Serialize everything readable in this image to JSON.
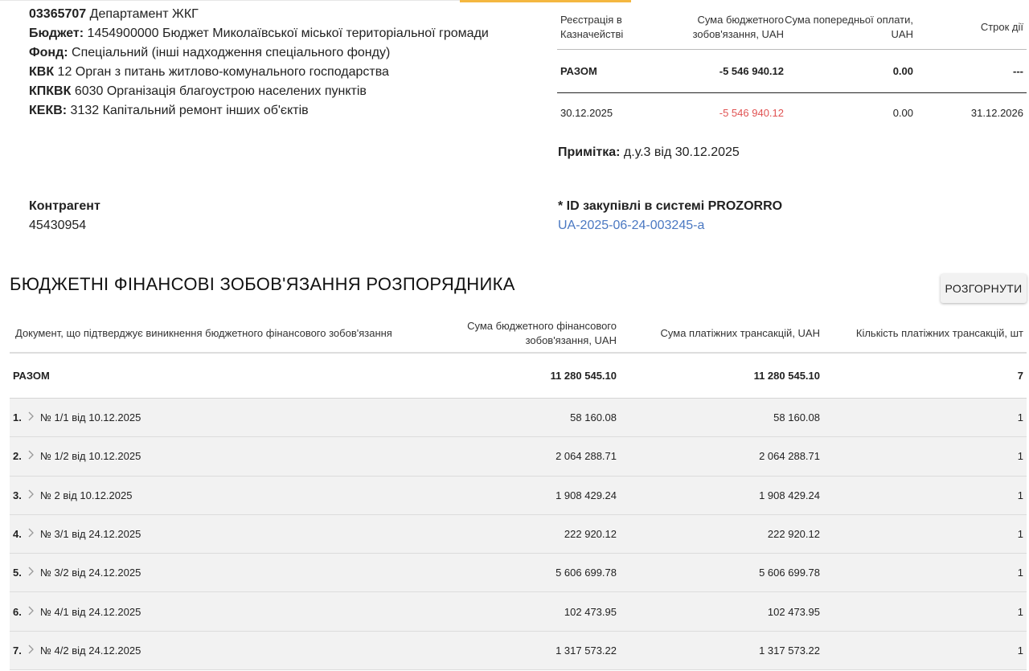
{
  "info": {
    "org_code": "03365707",
    "org_name": "Департамент ЖКГ",
    "budget_label": "Бюджет:",
    "budget_value": "1454900000 Бюджет Миколаївської міської територіальної громади",
    "fund_label": "Фонд:",
    "fund_value": "Спеціальний (інші надходження спеціального фонду)",
    "kvk_label": "КВК",
    "kvk_value": "12 Орган з питань житлово-комунального господарства",
    "kpkvk_label": "КПКВК",
    "kpkvk_value": "6030 Організація благоустрою населених пунктів",
    "kekv_label": "КЕКВ:",
    "kekv_value": "3132 Капітальний ремонт інших об'єктів"
  },
  "contragent": {
    "label": "Контрагент",
    "value": "45430954"
  },
  "registry_table": {
    "headers": [
      "Реєстрація в Казначействі",
      "Сума бюджетного зобов'язання, UAH",
      "Сума попередньої оплати, UAH",
      "Строк дії"
    ],
    "total": [
      "РАЗОМ",
      "-5 546 940.12",
      "0.00",
      "---"
    ],
    "row": [
      "30.12.2025",
      "-5 546 940.12",
      "0.00",
      "31.12.2026"
    ]
  },
  "note": {
    "label": "Примітка:",
    "value": "д.у.3 від 30.12.2025"
  },
  "prozorro": {
    "label": "* ID закупівлі в системі PROZORRO",
    "link": "UA-2025-06-24-003245-a"
  },
  "section": {
    "title": "БЮДЖЕТНІ ФІНАНСОВІ ЗОБОВ'ЯЗАННЯ РОЗПОРЯДНИКА",
    "expand_label": "РОЗГОРНУТИ"
  },
  "obligations": {
    "headers": [
      "Документ, що підтверджує виникнення бюджетного фінансового зобов'язання",
      "Сума бюджетного фінансового зобов'язання, UAH",
      "Сума платіжних трансакцій, UAH",
      "Кількість платіжних трансакцій, шт"
    ],
    "total": {
      "label": "РАЗОМ",
      "sum": "11 280 545.10",
      "paid": "11 280 545.10",
      "count": "7"
    },
    "rows": [
      {
        "n": "1.",
        "doc": "№ 1/1 від 10.12.2025",
        "sum": "58 160.08",
        "paid": "58 160.08",
        "count": "1"
      },
      {
        "n": "2.",
        "doc": "№ 1/2 від 10.12.2025",
        "sum": "2 064 288.71",
        "paid": "2 064 288.71",
        "count": "1"
      },
      {
        "n": "3.",
        "doc": "№ 2 від 10.12.2025",
        "sum": "1 908 429.24",
        "paid": "1 908 429.24",
        "count": "1"
      },
      {
        "n": "4.",
        "doc": "№ 3/1 від 24.12.2025",
        "sum": "222 920.12",
        "paid": "222 920.12",
        "count": "1"
      },
      {
        "n": "5.",
        "doc": "№ 3/2 від 24.12.2025",
        "sum": "5 606 699.78",
        "paid": "5 606 699.78",
        "count": "1"
      },
      {
        "n": "6.",
        "doc": "№ 4/1 від 24.12.2025",
        "sum": "102 473.95",
        "paid": "102 473.95",
        "count": "1"
      },
      {
        "n": "7.",
        "doc": "№ 4/2 від 24.12.2025",
        "sum": "1 317 573.22",
        "paid": "1 317 573.22",
        "count": "1"
      }
    ]
  },
  "colors": {
    "accent": "#f4b740",
    "negative": "#e05252",
    "link": "#4a78c2"
  },
  "icons": {
    "row_expand": "chevron-right-icon"
  }
}
